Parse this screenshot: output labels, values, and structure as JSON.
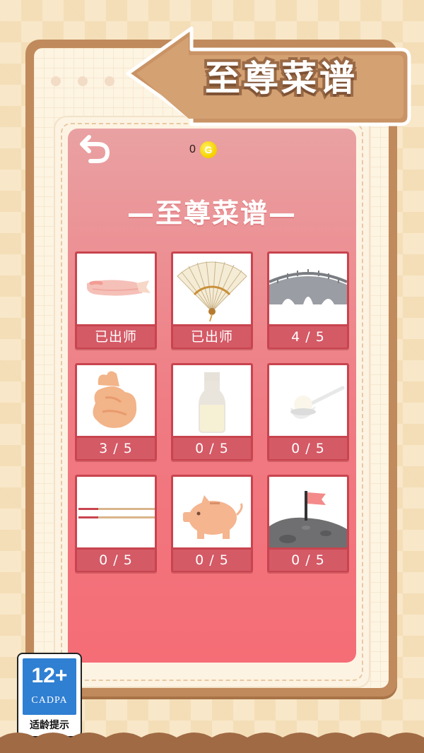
{
  "banner": {
    "title": "至尊菜谱"
  },
  "header": {
    "back_icon": "back-arrow-icon",
    "coins": "0",
    "coin_symbol": "G"
  },
  "panel": {
    "heading": "—至尊菜谱—"
  },
  "recipes": [
    {
      "icon": "shrimp-icon",
      "status": "已出师"
    },
    {
      "icon": "folding-fan-icon",
      "status": "已出师"
    },
    {
      "icon": "stone-bridge-icon",
      "status": "4 / 5"
    },
    {
      "icon": "fried-snack-icon",
      "status": "3 / 5"
    },
    {
      "icon": "milk-bottle-icon",
      "status": "0 / 5"
    },
    {
      "icon": "spoon-dumpling-icon",
      "status": "0 / 5"
    },
    {
      "icon": "chopsticks-icon",
      "status": "0 / 5"
    },
    {
      "icon": "piggy-bank-icon",
      "status": "0 / 5"
    },
    {
      "icon": "moon-flag-icon",
      "status": "0 / 5"
    }
  ],
  "age_rating": {
    "number": "12+",
    "org": "CADPA",
    "text": "适龄提示"
  },
  "colors": {
    "panel_top": "#e9a1a2",
    "panel_bottom": "#f56d76",
    "card_border": "#c8444f",
    "label_bg": "#d45a66",
    "frame": "#c08a5c"
  }
}
